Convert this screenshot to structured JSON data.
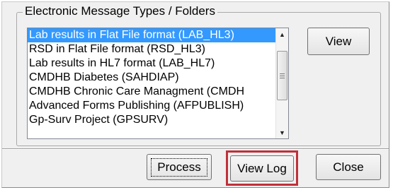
{
  "group": {
    "title": "Electronic Message Types / Folders"
  },
  "list": {
    "items": [
      "Lab results in Flat File format (LAB_HL3)",
      "RSD in Flat File format (RSD_HL3)",
      "Lab results in HL7 format (LAB_HL7)",
      "CMDHB Diabetes (SAHDIAP)",
      "CMDHB Chronic Care Managment (CMDH",
      "Advanced Forms Publishing (AFPUBLISH)",
      "Gp-Surv Project (GPSURV)"
    ],
    "selected_index": 0
  },
  "buttons": {
    "view": "View",
    "process": "Process",
    "view_log": "View Log",
    "close": "Close"
  },
  "colors": {
    "selection": "#3399ff",
    "highlight_box": "#c0303a"
  }
}
